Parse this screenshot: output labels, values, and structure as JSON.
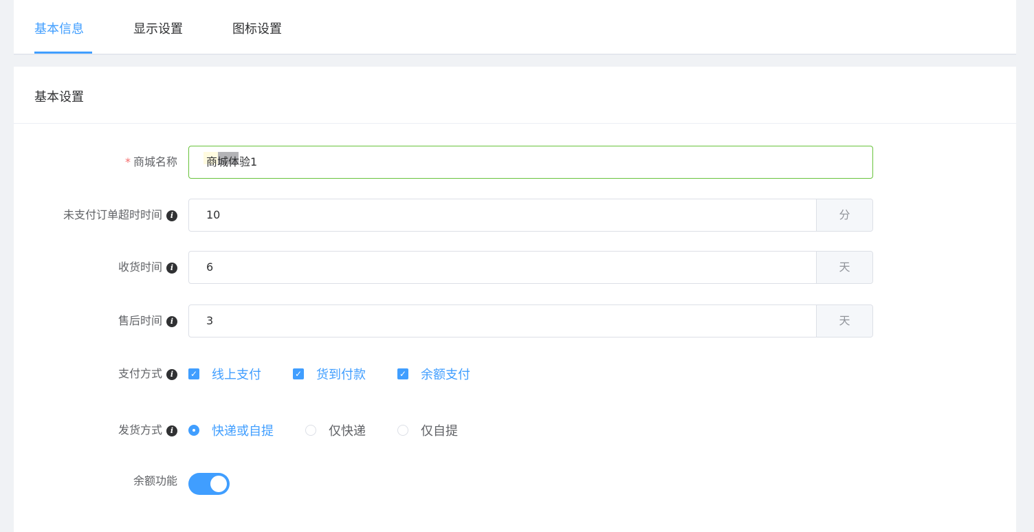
{
  "tabs": [
    "基本信息",
    "显示设置",
    "图标设置"
  ],
  "section_title": "基本设置",
  "colors": {
    "accent": "#409eff",
    "focus_border": "#67c23a",
    "required": "#f56c6c"
  },
  "form": {
    "shop_name": {
      "label": "商城名称",
      "required_mark": "*",
      "value": "商城体验1"
    },
    "unpaid_timeout": {
      "label": "未支付订单超时时间",
      "value": "10",
      "unit": "分"
    },
    "receive_time": {
      "label": "收货时间",
      "value": "6",
      "unit": "天"
    },
    "after_sale_time": {
      "label": "售后时间",
      "value": "3",
      "unit": "天"
    },
    "payment": {
      "label": "支付方式",
      "options": [
        {
          "label": "线上支付",
          "checked": true
        },
        {
          "label": "货到付款",
          "checked": true
        },
        {
          "label": "余额支付",
          "checked": true
        }
      ]
    },
    "delivery": {
      "label": "发货方式",
      "options": [
        {
          "label": "快递或自提",
          "selected": true
        },
        {
          "label": "仅快递",
          "selected": false
        },
        {
          "label": "仅自提",
          "selected": false
        }
      ]
    },
    "balance": {
      "label": "余额功能",
      "enabled": true
    }
  },
  "icons": {
    "info": "info-icon",
    "check": "check-icon"
  }
}
